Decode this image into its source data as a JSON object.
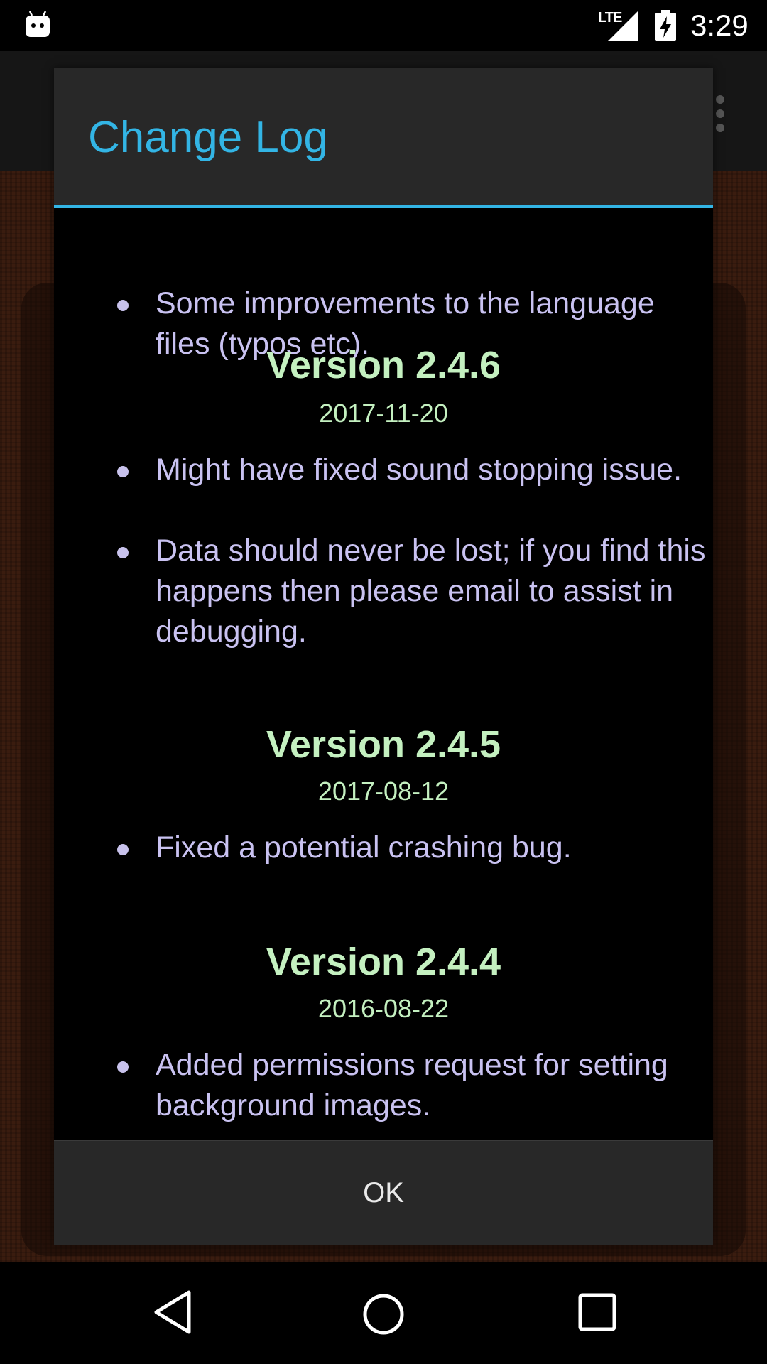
{
  "status_bar": {
    "network_label": "LTE",
    "time": "3:29",
    "icons": [
      "android-icon",
      "lte-signal-icon",
      "battery-charging-icon"
    ]
  },
  "app": {
    "overflow_icon": "overflow-menu-icon"
  },
  "dialog": {
    "title": "Change Log",
    "accent_color": "#33b5e5",
    "top_item": "Some improvements to the language files (typos etc).",
    "versions": [
      {
        "version": "Version 2.4.6",
        "date": "2017-11-20",
        "items": [
          "Might have fixed sound stopping issue.",
          "Data should never be lost; if you find this happens then please email to assist in debugging."
        ]
      },
      {
        "version": "Version 2.4.5",
        "date": "2017-08-12",
        "items": [
          "Fixed a potential crashing bug."
        ]
      },
      {
        "version": "Version 2.4.4",
        "date": "2016-08-22",
        "items": [
          "Added permissions request for setting background images."
        ]
      }
    ],
    "ok_label": "OK"
  },
  "nav_bar": {
    "icons": [
      "back-icon",
      "home-icon",
      "recents-icon"
    ]
  }
}
